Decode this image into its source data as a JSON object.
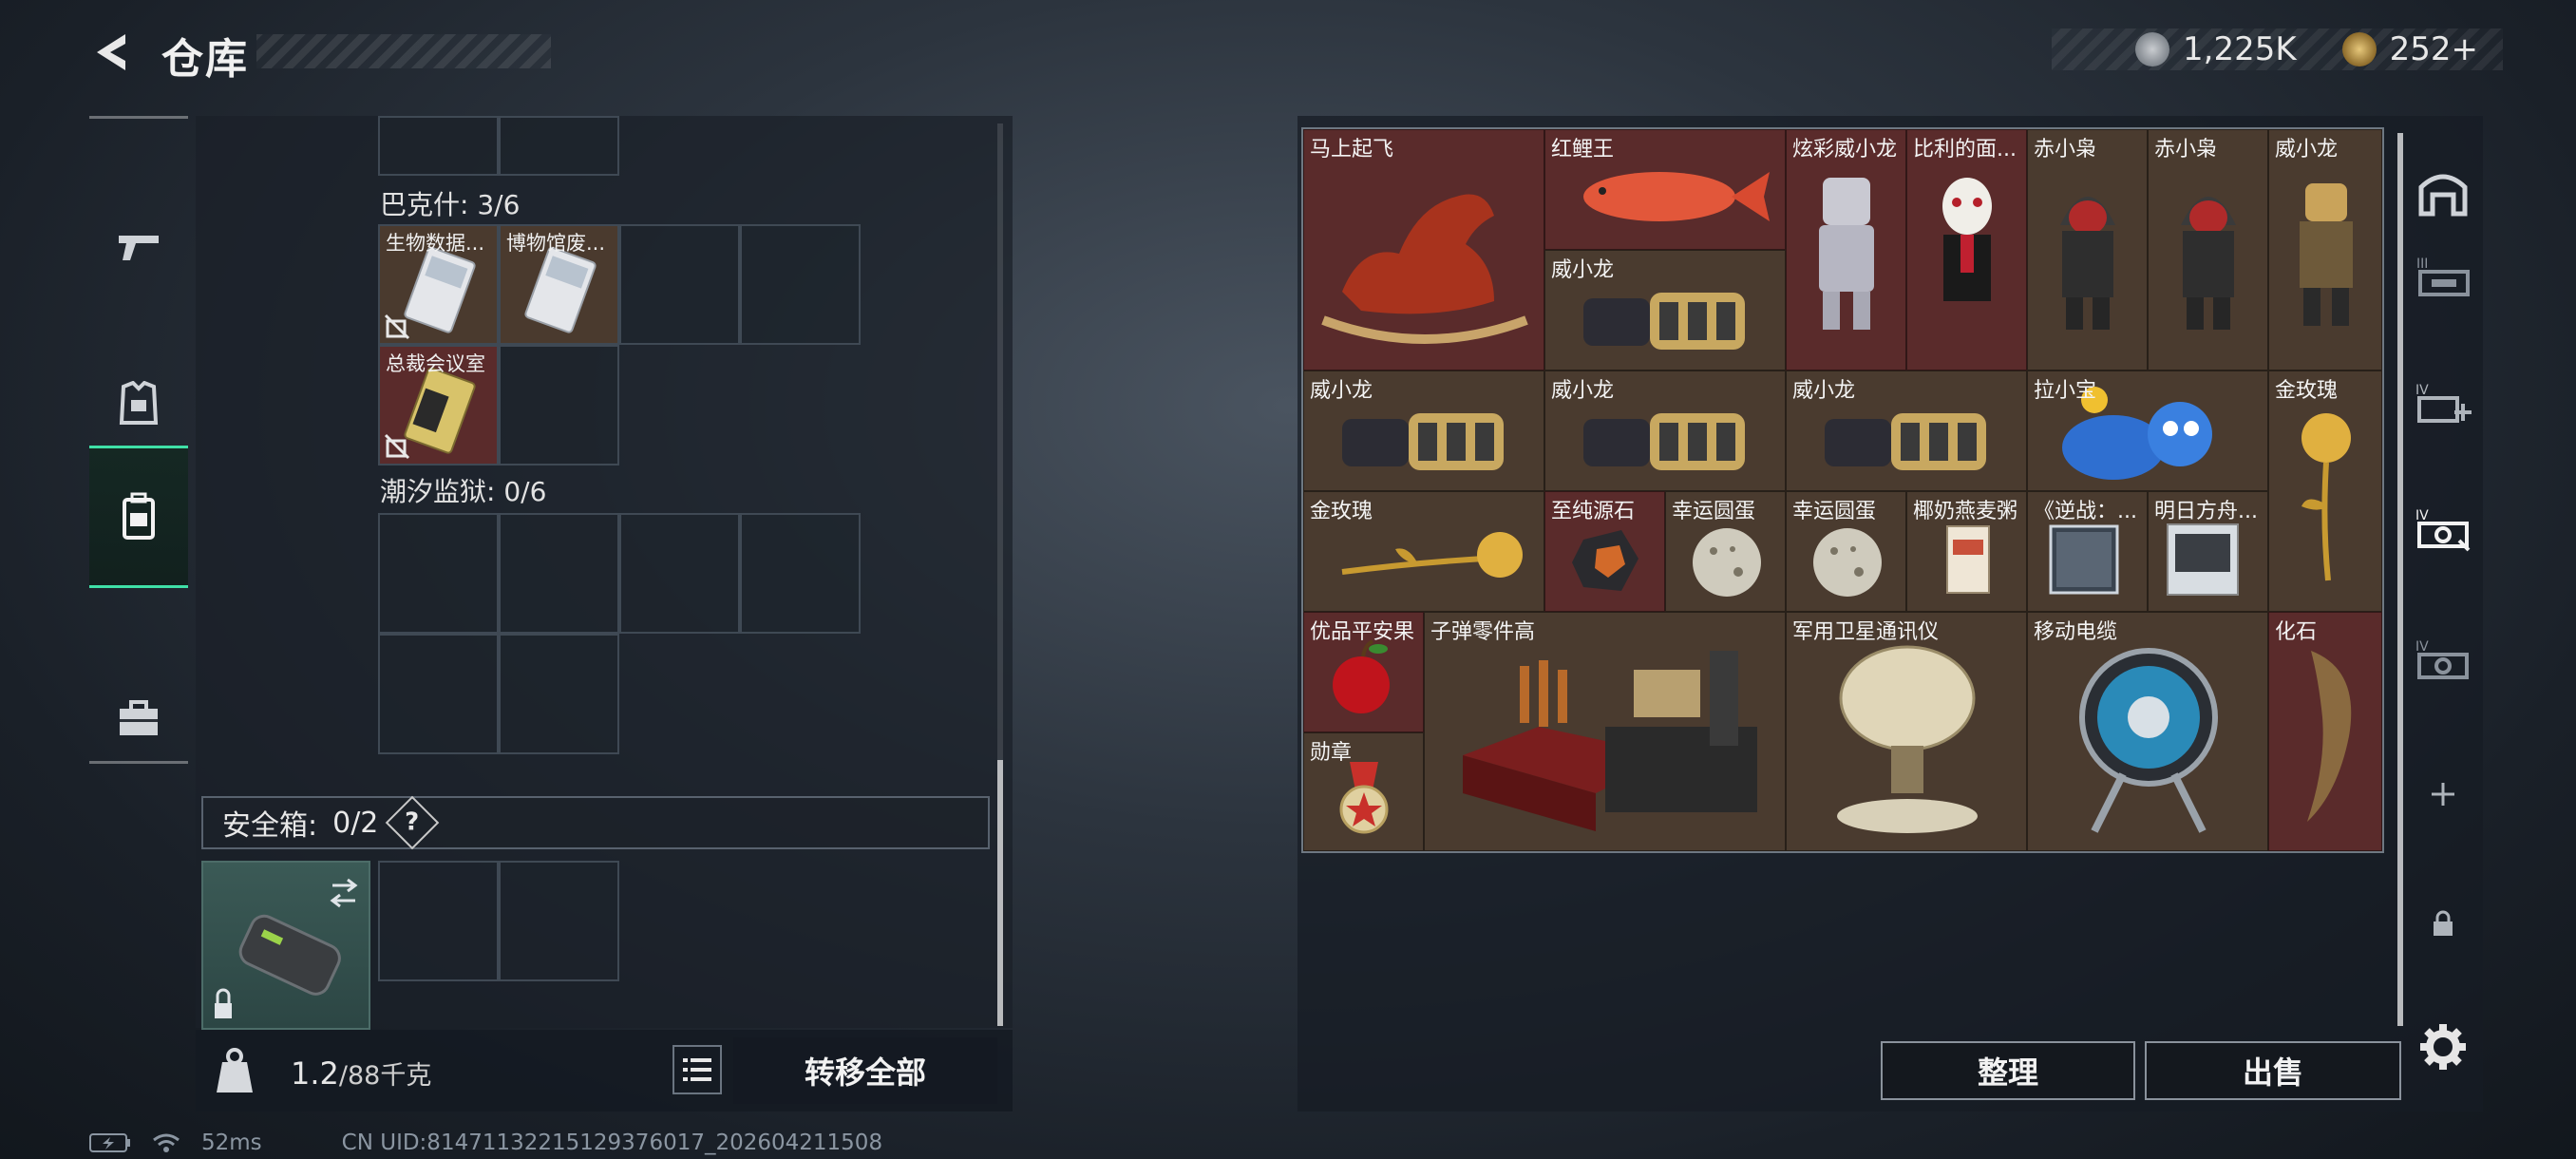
{
  "header": {
    "title": "仓库",
    "currency_1": "1,225K",
    "currency_2": "252+"
  },
  "backpack": {
    "section_bakeshi": "巴克什: 3/6",
    "section_chaoxi": "潮汐监狱: 0/6",
    "items": [
      {
        "label": "生物数据..."
      },
      {
        "label": "博物馆废..."
      },
      {
        "label": "总裁会议室"
      }
    ],
    "safe_box_label": "安全箱:",
    "safe_box_count": "0/2",
    "safe_box_help": "?",
    "weight_value": "1.2",
    "weight_total": "/88千克",
    "transfer_all": "转移全部"
  },
  "storage": {
    "items": [
      {
        "label": "马上起飞",
        "rarity": "red"
      },
      {
        "label": "红鲤王",
        "rarity": "red"
      },
      {
        "label": "炫彩威小龙",
        "rarity": "red"
      },
      {
        "label": "比利的面...",
        "rarity": "brown"
      },
      {
        "label": "赤小枭",
        "rarity": "brown"
      },
      {
        "label": "赤小枭",
        "rarity": "brown"
      },
      {
        "label": "威小龙",
        "rarity": "brown"
      },
      {
        "label": "威小龙",
        "rarity": "brown"
      },
      {
        "label": "威小龙",
        "rarity": "brown"
      },
      {
        "label": "威小龙",
        "rarity": "brown"
      },
      {
        "label": "威小龙",
        "rarity": "brown"
      },
      {
        "label": "拉小宝",
        "rarity": "brown"
      },
      {
        "label": "金玫瑰",
        "rarity": "brown"
      },
      {
        "label": "金玫瑰",
        "rarity": "brown"
      },
      {
        "label": "至纯源石",
        "rarity": "red"
      },
      {
        "label": "幸运圆蛋",
        "rarity": "brown"
      },
      {
        "label": "幸运圆蛋",
        "rarity": "brown"
      },
      {
        "label": "椰奶燕麦粥",
        "rarity": "brown"
      },
      {
        "label": "《逆战：...",
        "rarity": "brown"
      },
      {
        "label": "明日方舟...",
        "rarity": "brown"
      },
      {
        "label": "优品平安果",
        "rarity": "red"
      },
      {
        "label": "子弹零件高",
        "rarity": "brown"
      },
      {
        "label": "军用卫星通讯仪",
        "rarity": "brown"
      },
      {
        "label": "移动电缆",
        "rarity": "brown"
      },
      {
        "label": "化石",
        "rarity": "red"
      },
      {
        "label": "勋章",
        "rarity": "brown"
      }
    ],
    "sort_button": "整理",
    "sell_button": "出售"
  },
  "status_bar": {
    "ping": "52ms",
    "uid": "CN UID:81471132215129376017_202604211508"
  },
  "colors": {
    "accent": "#3fe0a7",
    "rarity_red": "#5a2b2b",
    "rarity_brown": "#4a3b2f"
  }
}
